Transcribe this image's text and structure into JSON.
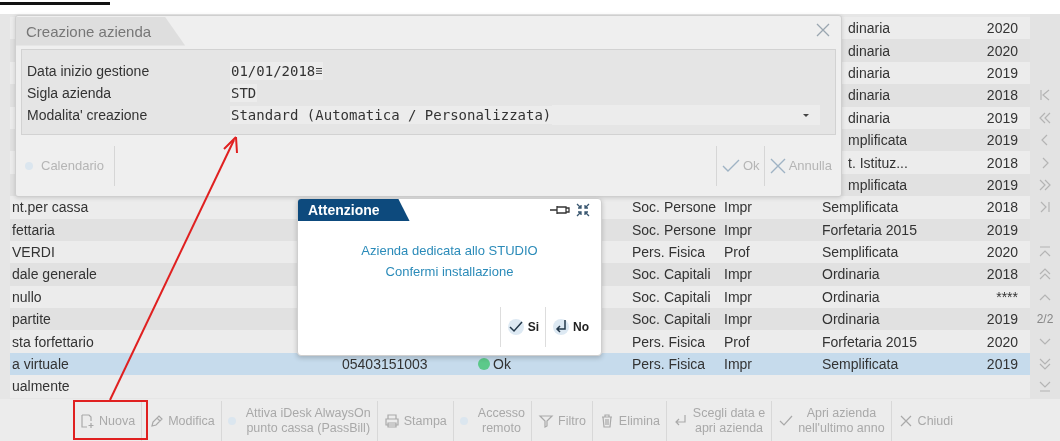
{
  "dialog": {
    "title": "Creazione azienda",
    "fields": [
      {
        "label": "Data inizio gestione",
        "value": "01/01/2018",
        "kind": "date"
      },
      {
        "label": "Sigla azienda",
        "value": "STD",
        "kind": "text"
      },
      {
        "label": "Modalita' creazione",
        "value": "Standard (Automatica / Personalizzata)",
        "kind": "select"
      }
    ],
    "left_button": {
      "label": "Calendario",
      "disabled": true
    },
    "buttons": [
      {
        "label": "Ok",
        "kind": "ok",
        "disabled": true
      },
      {
        "label": "Annulla",
        "kind": "cancel",
        "disabled": true
      }
    ]
  },
  "alert": {
    "title": "Attenzione",
    "message": [
      "Azienda dedicata allo STUDIO",
      "Confermi installazione"
    ],
    "buttons": [
      {
        "label": "Si",
        "kind": "yes"
      },
      {
        "label": "No",
        "kind": "no"
      }
    ]
  },
  "table": {
    "rows": [
      {
        "kind": "covered",
        "selected": false,
        "regime": "dinaria",
        "year": "2020"
      },
      {
        "kind": "covered",
        "selected": false,
        "regime": "dinaria",
        "year": "2020"
      },
      {
        "kind": "covered",
        "selected": false,
        "regime": "dinaria",
        "year": "2019"
      },
      {
        "kind": "covered",
        "selected": false,
        "regime": "dinaria",
        "year": "2018"
      },
      {
        "kind": "covered",
        "selected": false,
        "regime": "dinaria",
        "year": "2019"
      },
      {
        "kind": "covered",
        "selected": false,
        "regime": "mplificata",
        "year": "2019"
      },
      {
        "kind": "covered",
        "selected": false,
        "regime": "t. Istituz...",
        "year": "2018"
      },
      {
        "kind": "covered",
        "selected": false,
        "regime": "mplificata",
        "year": "2019"
      },
      {
        "kind": "full",
        "selected": false,
        "name": "nt.per cassa",
        "type": "Soc. Persone",
        "activity": "Impr",
        "regime": "Semplificata",
        "year": "2018"
      },
      {
        "kind": "full",
        "selected": false,
        "name": "fettaria",
        "type": "Soc. Persone",
        "activity": "Impr",
        "regime": "Forfetaria 2015",
        "year": "2019"
      },
      {
        "kind": "full",
        "selected": false,
        "name": "VERDI",
        "type": "Pers. Fisica",
        "activity": "Prof",
        "regime": "Semplificata",
        "year": "2020"
      },
      {
        "kind": "full",
        "selected": false,
        "name": "dale generale",
        "type": "Soc. Capitali",
        "activity": "Impr",
        "regime": "Ordinaria",
        "year": "2018"
      },
      {
        "kind": "full",
        "selected": false,
        "name": "nullo",
        "type": "Soc. Capitali",
        "activity": "Impr",
        "regime": "Ordinaria",
        "year": "****"
      },
      {
        "kind": "full",
        "selected": false,
        "name": "partite",
        "type": "Soc. Capitali",
        "activity": "Impr",
        "regime": "Ordinaria",
        "year": "2019"
      },
      {
        "kind": "full",
        "selected": false,
        "name": "sta forfettario",
        "type": "Pers. Fisica",
        "activity": "Prof",
        "regime": "Forfetaria 2015",
        "year": "2020"
      },
      {
        "kind": "full",
        "selected": true,
        "name": "a virtuale",
        "vat": "05403151003",
        "status": {
          "label": "Ok",
          "color": "#5cc98a"
        },
        "type": "Pers. Fisica",
        "activity": "Impr",
        "regime": "Semplificata",
        "year": "2019"
      },
      {
        "kind": "full",
        "selected": false,
        "name": "ualmente"
      }
    ]
  },
  "pager": {
    "page": "2/2"
  },
  "toolbar": [
    {
      "kind": "new",
      "lines": [
        "Nuova"
      ],
      "disabled": true
    },
    {
      "kind": "edit",
      "lines": [
        "Modifica"
      ],
      "disabled": true
    },
    {
      "kind": "dot",
      "lines": [
        "Attiva iDesk AlwaysOn",
        "punto cassa (PassBill)"
      ],
      "disabled": true
    },
    {
      "kind": "print",
      "lines": [
        "Stampa"
      ],
      "disabled": true
    },
    {
      "kind": "dot",
      "lines": [
        "Accesso",
        "remoto"
      ],
      "disabled": true
    },
    {
      "kind": "filter",
      "lines": [
        "Filtro"
      ],
      "disabled": true
    },
    {
      "kind": "trash",
      "lines": [
        "Elimina"
      ],
      "disabled": true
    },
    {
      "kind": "enter",
      "lines": [
        "Scegli data e",
        "apri azienda"
      ],
      "disabled": true
    },
    {
      "kind": "check",
      "lines": [
        "Apri azienda",
        "nell'ultimo anno"
      ],
      "disabled": true
    },
    {
      "kind": "close",
      "lines": [
        "Chiudi"
      ],
      "disabled": true
    }
  ]
}
